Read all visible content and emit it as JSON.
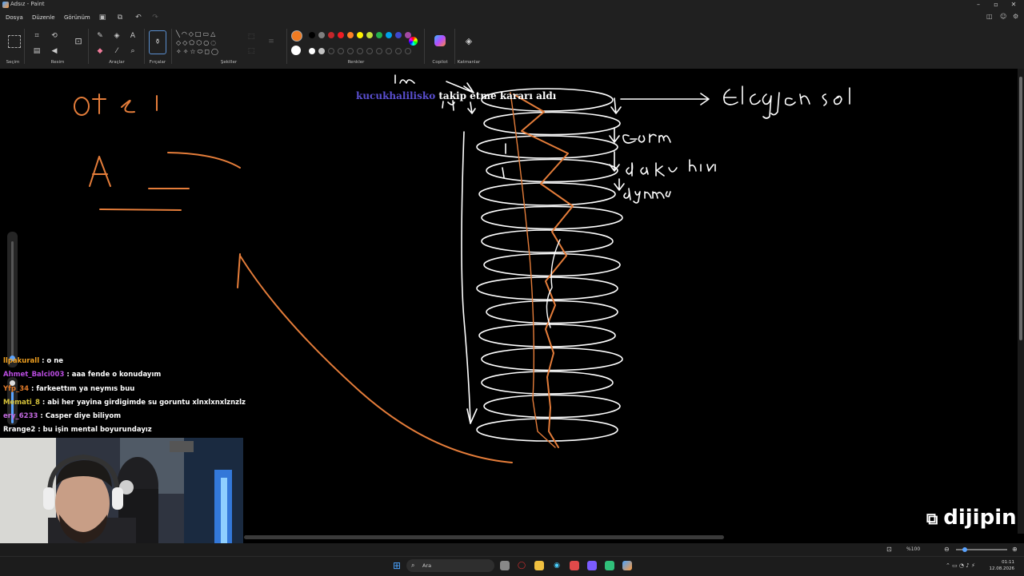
{
  "window": {
    "title": "Adsız - Paint"
  },
  "menu": {
    "file": "Dosya",
    "edit": "Düzenle",
    "view": "Görünüm"
  },
  "ribbon": {
    "groups": {
      "selection": "Seçim",
      "image": "Resim",
      "tools": "Araçlar",
      "brushes": "Fırçalar",
      "shapes": "Şekiller",
      "colors": "Renkler",
      "copilot": "Copilot",
      "layers": "Katmanlar"
    },
    "primary_color": "#f07b22",
    "secondary_color": "#ffffff",
    "palette_row1": [
      "#000000",
      "#7f7f7f",
      "#c3272b",
      "#ee1c24",
      "#ff7f27",
      "#fff200",
      "#c3e03a",
      "#22b14c",
      "#00a2e8",
      "#3f48cc",
      "#a349a4"
    ],
    "palette_row2": [
      "#ffffff",
      "#c3c3c3",
      "#b97a57",
      "#ffaec9",
      "#ffc90e",
      "#efe4b0",
      "#b5e61d",
      "#99d9ea",
      "#7092be",
      "#c8bfe7",
      "#e0e0e0"
    ]
  },
  "overlay": {
    "follow_user": "kucukhalilisko",
    "follow_text": " takip etme kararı aldı",
    "brand": "dijipin"
  },
  "chat": [
    {
      "user": "llpakurall",
      "color": "#f0a020",
      "text": " : o ne"
    },
    {
      "user": "Ahmet_Balci003",
      "color": "#b94ce0",
      "text": " : aaa fende o konudayım"
    },
    {
      "user": "Yfp_34",
      "color": "#e07a2a",
      "text": " : farkeettım ya neymıs buu"
    },
    {
      "user": "Memati_8",
      "color": "#d6c23a",
      "text": " : abi her yayina girdigimde su goruntu xlnxlxnxlznzlz"
    },
    {
      "user": "ery_6233",
      "color": "#c46ae0",
      "text": " : Casper diye biliyom"
    },
    {
      "user": "Rrange2",
      "color": "#ffffff",
      "text": " : bu işin mental boyurundayız"
    }
  ],
  "status": {
    "zoom": "%100"
  },
  "taskbar": {
    "search_placeholder": "Ara",
    "time": "01:11",
    "date": "12.08.2026"
  },
  "icons": [
    "paint-app-icon",
    "minimize-icon",
    "maximize-icon",
    "close-icon",
    "save-icon",
    "open-icon",
    "undo-icon",
    "redo-icon",
    "select-icon",
    "crop-icon",
    "rotate-icon",
    "resize-icon",
    "pencil-icon",
    "fill-icon",
    "text-icon",
    "eraser-icon",
    "color-picker-icon",
    "magnifier-icon",
    "brush-icon",
    "shapes-icon",
    "color-wheel-icon",
    "copilot-icon",
    "layers-icon",
    "windows-start-icon",
    "search-icon",
    "fit-screen-icon",
    "zoom-out-icon",
    "zoom-in-icon"
  ]
}
